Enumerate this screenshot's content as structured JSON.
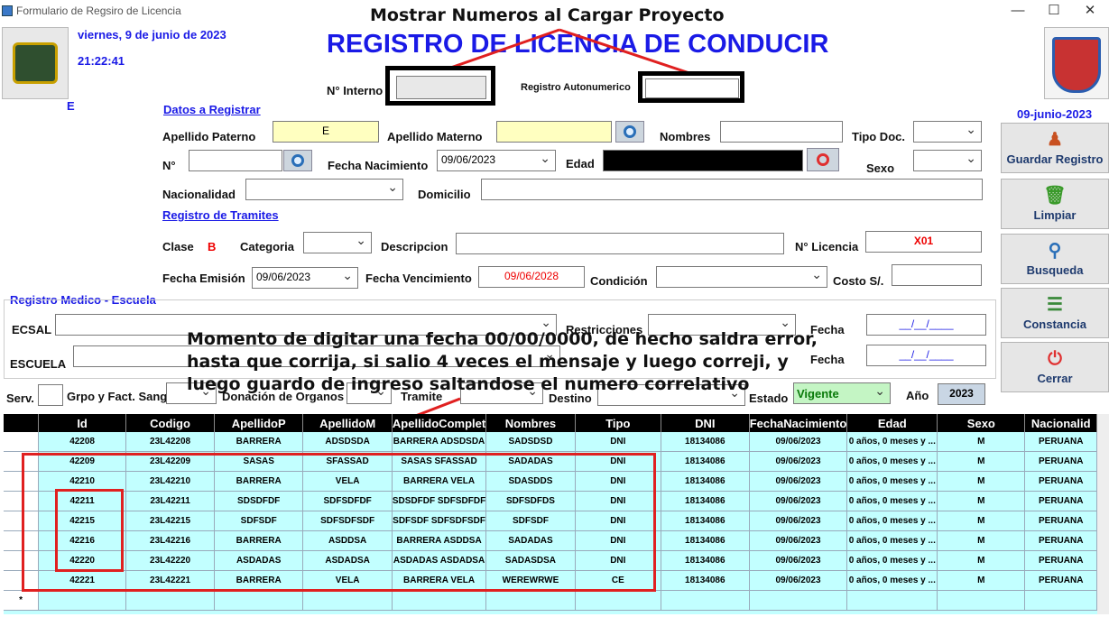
{
  "window": {
    "title": "Formulario de Regsiro de Licencia",
    "min": "—",
    "max": "☐",
    "close": "✕"
  },
  "header": {
    "date_text": "viernes, 9 de junio de 2023",
    "time_text": "21:22:41",
    "letter_e": "E",
    "main_title": "REGISTRO DE LICENCIA DE CONDUCIR",
    "n_interno_label": "N° Interno",
    "registro_autonumerico_label": "Registro Autonumerico",
    "side_date": "09-junio-2023"
  },
  "annotations": {
    "top": "Mostrar Numeros al Cargar Proyecto",
    "middle": "Momento de digitar una fecha 00/00/0000, de hecho saldra error, hasta que corrija, si salio 4 veces el mensaje y luego correji, y luego guardo de ingreso saltandose el numero correlativo"
  },
  "datos": {
    "section_link": "Datos a Registrar",
    "apellido_paterno_label": "Apellido Paterno",
    "apellido_paterno_value": "E",
    "apellido_materno_label": "Apellido Materno",
    "apellido_materno_value": "",
    "nombres_label": "Nombres",
    "tipo_doc_label": "Tipo Doc.",
    "n_label": "N°",
    "fecha_nac_label": "Fecha Nacimiento",
    "fecha_nac_value": "09/06/2023",
    "edad_label": "Edad",
    "sexo_label": "Sexo",
    "nacionalidad_label": "Nacionalidad",
    "domicilio_label": "Domicilio"
  },
  "tramites": {
    "section_link": "Registro de Tramites",
    "clase_label": "Clase",
    "clase_value": "B",
    "categoria_label": "Categoria",
    "descripcion_label": "Descripcion",
    "n_licencia_label": "N° Licencia",
    "n_licencia_value": "X01",
    "fecha_emision_label": "Fecha Emisión",
    "fecha_emision_value": "09/06/2023",
    "fecha_venc_label": "Fecha Vencimiento",
    "fecha_venc_value": "09/06/2028",
    "condicion_label": "Condición",
    "costo_label": "Costo S/."
  },
  "medico": {
    "section_title": "Registro Medico - Escuela",
    "ecsal_label": "ECSAL",
    "escuela_label": "ESCUELA",
    "restricciones_label": "Restricciones",
    "fecha_label_1": "Fecha",
    "fecha_label_2": "Fecha",
    "fecha_value_1": "__/__/____",
    "fecha_value_2": "__/__/____"
  },
  "bottom": {
    "serv_label": "Serv.",
    "grpo_label": "Grpo y Fact. Sang.",
    "donacion_label": "Donación de Organos",
    "tramite_label": "Tramite",
    "destino_label": "Destino",
    "estado_label": "Estado",
    "estado_value": "Vigente",
    "anio_label": "Año",
    "anio_value": "2023"
  },
  "side_buttons": [
    {
      "label": "Guardar Registro",
      "icon": "user-icon"
    },
    {
      "label": "Limpiar",
      "icon": "trash-icon"
    },
    {
      "label": "Busqueda",
      "icon": "search-icon"
    },
    {
      "label": "Constancia",
      "icon": "document-icon"
    },
    {
      "label": "Cerrar",
      "icon": "power-icon"
    }
  ],
  "grid": {
    "columns": [
      "",
      "Id",
      "Codigo",
      "ApellidoP",
      "ApellidoM",
      "ApellidoComplet",
      "Nombres",
      "Tipo",
      "DNI",
      "FechaNacimiento",
      "Edad",
      "Sexo",
      "Nacionalid"
    ],
    "rows": [
      [
        "",
        "42208",
        "23L42208",
        "BARRERA",
        "ADSDSDA",
        "BARRERA ADSDSDA",
        "SADSDSD",
        "DNI",
        "18134086",
        "09/06/2023",
        "0 años, 0 meses y ...",
        "M",
        "PERUANA"
      ],
      [
        "",
        "42209",
        "23L42209",
        "SASAS",
        "SFASSAD",
        "SASAS SFASSAD",
        "SADADAS",
        "DNI",
        "18134086",
        "09/06/2023",
        "0 años, 0 meses y ...",
        "M",
        "PERUANA"
      ],
      [
        "",
        "42210",
        "23L42210",
        "BARRERA",
        "VELA",
        "BARRERA VELA",
        "SDASDDS",
        "DNI",
        "18134086",
        "09/06/2023",
        "0 años, 0 meses y ...",
        "M",
        "PERUANA"
      ],
      [
        "",
        "42211",
        "23L42211",
        "SDSDFDF",
        "SDFSDFDF",
        "SDSDFDF SDFSDFDF",
        "SDFSDFDS",
        "DNI",
        "18134086",
        "09/06/2023",
        "0 años, 0 meses y ...",
        "M",
        "PERUANA"
      ],
      [
        "",
        "42215",
        "23L42215",
        "SDFSDF",
        "SDFSDFSDF",
        "SDFSDF SDFSDFSDF",
        "SDFSDF",
        "DNI",
        "18134086",
        "09/06/2023",
        "0 años, 0 meses y ...",
        "M",
        "PERUANA"
      ],
      [
        "",
        "42216",
        "23L42216",
        "BARRERA",
        "ASDDSA",
        "BARRERA ASDDSA",
        "SADADAS",
        "DNI",
        "18134086",
        "09/06/2023",
        "0 años, 0 meses y ...",
        "M",
        "PERUANA"
      ],
      [
        "",
        "42220",
        "23L42220",
        "ASDADAS",
        "ASDADSA",
        "ASDADAS ASDADSA",
        "SADASDSA",
        "DNI",
        "18134086",
        "09/06/2023",
        "0 años, 0 meses y ...",
        "M",
        "PERUANA"
      ],
      [
        "",
        "42221",
        "23L42221",
        "BARRERA",
        "VELA",
        "BARRERA VELA",
        "WEREWRWE",
        "CE",
        "18134086",
        "09/06/2023",
        "0 años, 0 meses y ...",
        "M",
        "PERUANA"
      ],
      [
        "*",
        "",
        "",
        "",
        "",
        "",
        "",
        "",
        "",
        "",
        "",
        "",
        ""
      ]
    ]
  },
  "colors": {
    "accent_blue": "#1a1ae6",
    "grid_row": "#c2ffff",
    "highlight_red": "#e02020"
  }
}
